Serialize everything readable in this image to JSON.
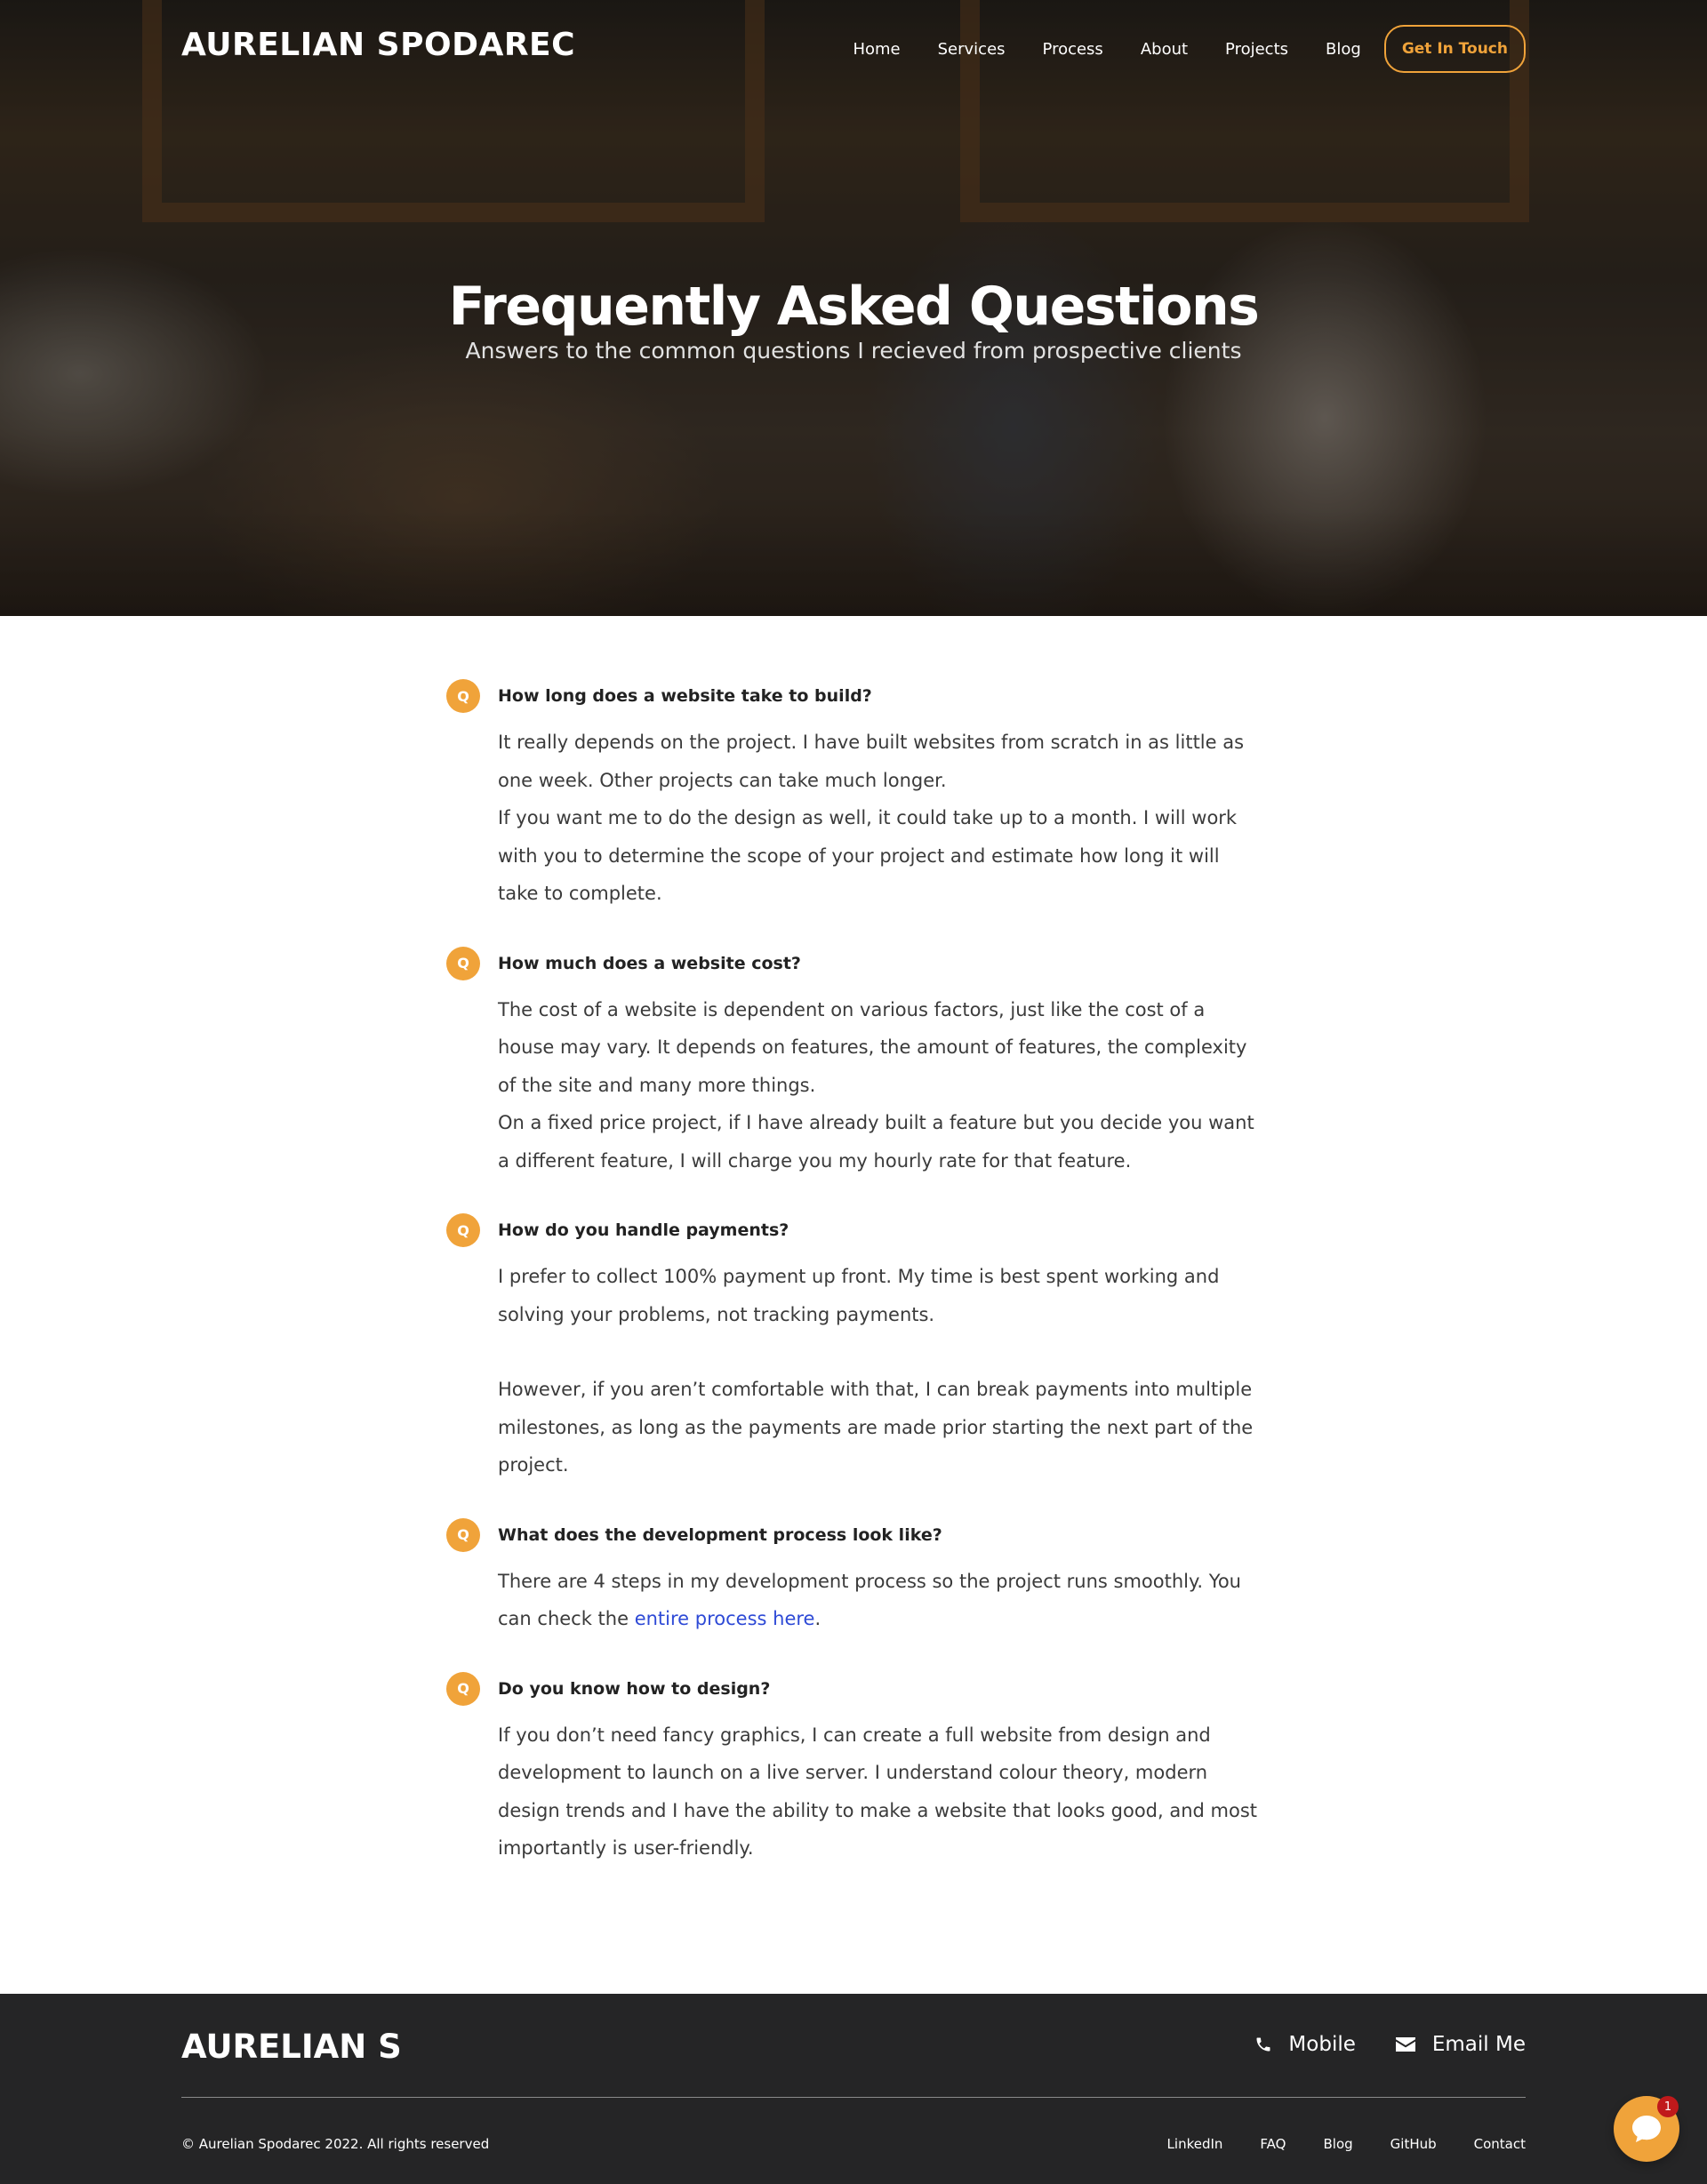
{
  "header": {
    "logo": "AURELIAN SPODAREC",
    "nav": [
      "Home",
      "Services",
      "Process",
      "About",
      "Projects",
      "Blog"
    ],
    "cta": "Get In Touch"
  },
  "hero": {
    "title": "Frequently Asked Questions",
    "subtitle": "Answers to the common questions I recieved from prospective clients"
  },
  "faq": {
    "badge": "Q",
    "items": [
      {
        "question": "How long does a website take to build?",
        "paragraphs": [
          "It really depends on the project. I have built websites from scratch in as little as one week. Other projects can take much longer.",
          "If you want me to do the design as well, it could take up to a month. I will work with you to determine the scope of your project and estimate how long it will take to complete."
        ]
      },
      {
        "question": "How much does a website cost?",
        "paragraphs": [
          "The cost of a website is dependent on various factors, just like the cost of a house may vary. It depends on features, the amount of features, the complexity of the site and many more things.",
          "On a fixed price project, if I have already built a feature but you decide you want a different feature, I will charge you my hourly rate for that feature."
        ]
      },
      {
        "question": "How do you handle payments?",
        "paragraphs": [
          "I prefer to collect 100% payment up front. My time is best spent working and solving your problems, not tracking payments.",
          "However, if you aren’t comfortable with that, I can break payments into multiple milestones, as long as the payments are made prior starting the next part of the project."
        ]
      },
      {
        "question": "What does the development process look like?",
        "text_before_link": "There are 4 steps in my development process so the project runs smoothly. You can check the ",
        "link_text": "entire process here",
        "text_after_link": "."
      },
      {
        "question": "Do you know how to design?",
        "paragraphs": [
          "If you don’t need fancy graphics, I can create a full website from design and development to launch on a live server. I understand colour theory, modern design trends and I have the ability to make a website that looks good, and most importantly is user-friendly."
        ]
      }
    ]
  },
  "footer": {
    "logo": "AURELIAN S",
    "mobile": "Mobile",
    "email": "Email Me",
    "copyright": "© Aurelian Spodarec 2022. All rights reserved",
    "links": [
      "LinkedIn",
      "FAQ",
      "Blog",
      "GitHub",
      "Contact"
    ]
  },
  "chat": {
    "badge_count": "1"
  },
  "colors": {
    "accent": "#f0a33a",
    "footer_bg": "#252526",
    "link": "#2e4ad6",
    "badge_red": "#c0191b"
  },
  "icons": [
    "phone-icon",
    "envelope-icon",
    "chat-bubble-icon"
  ]
}
